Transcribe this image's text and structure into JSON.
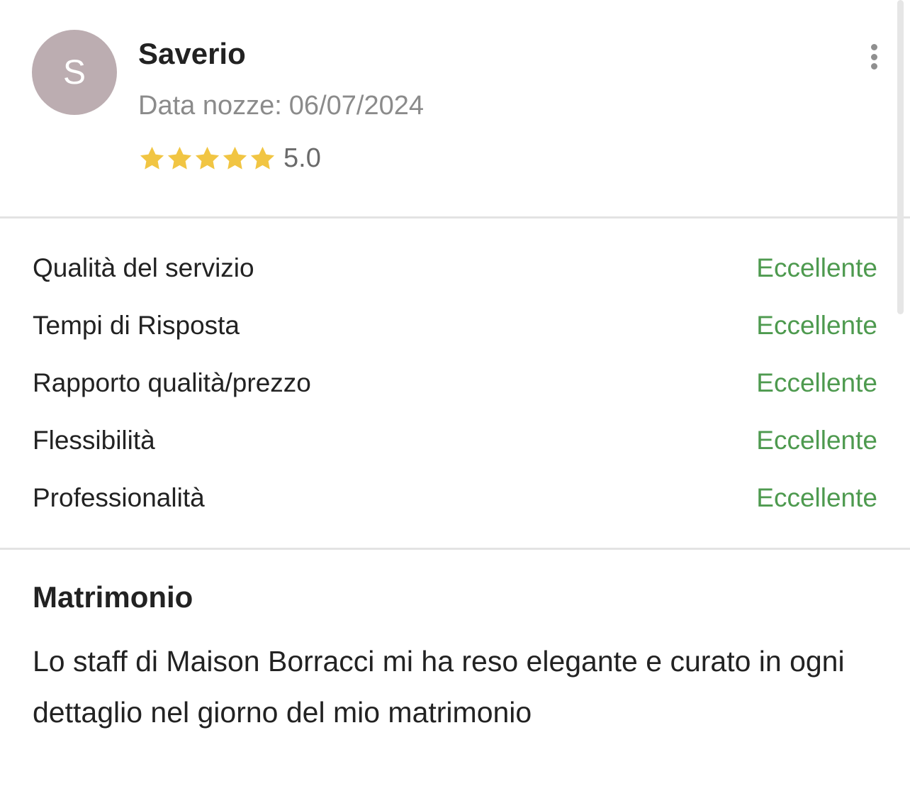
{
  "reviewer": {
    "initial": "S",
    "name": "Saverio",
    "date_label": "Data nozze:",
    "date_value": "06/07/2024",
    "stars": 5,
    "rating": "5.0"
  },
  "icons": {
    "avatar": "avatar-initial",
    "more": "vertical-ellipsis-icon",
    "star": "star-icon"
  },
  "colors": {
    "avatar_bg": "#bcadb1",
    "star": "#f1c543",
    "grade": "#4e9a4f",
    "muted": "#8b8b8b"
  },
  "ratings": [
    {
      "label": "Qualità del servizio",
      "grade": "Eccellente"
    },
    {
      "label": "Tempi di Risposta",
      "grade": "Eccellente"
    },
    {
      "label": "Rapporto qualità/prezzo",
      "grade": "Eccellente"
    },
    {
      "label": "Flessibilità",
      "grade": "Eccellente"
    },
    {
      "label": "Professionalità",
      "grade": "Eccellente"
    }
  ],
  "review": {
    "title": "Matrimonio",
    "text": "Lo staff di Maison Borracci mi ha reso elegante e curato in ogni dettaglio nel giorno del mio matrimonio"
  }
}
